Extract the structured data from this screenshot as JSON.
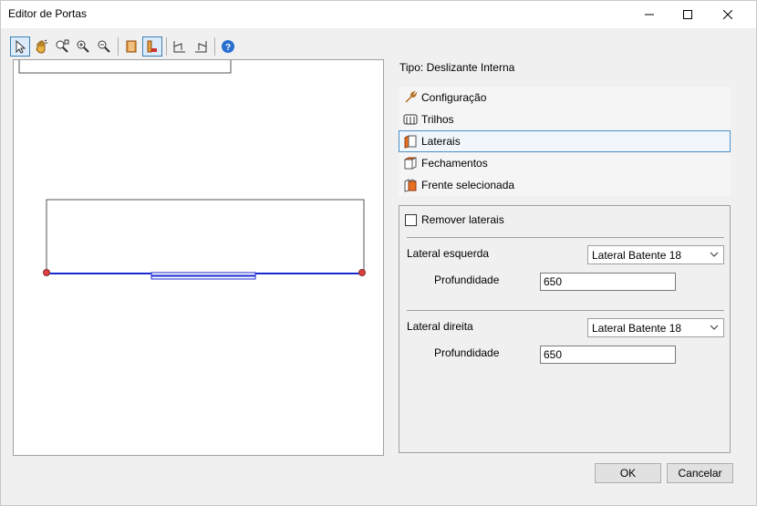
{
  "window": {
    "title": "Editor de Portas"
  },
  "toolbar": {
    "icons": [
      "select-arrow-icon",
      "pan-hand-icon",
      "zoom-window-icon",
      "zoom-in-icon",
      "zoom-out-icon",
      "door-front-icon",
      "door-side-icon",
      "perspective-left-icon",
      "perspective-right-icon",
      "help-icon"
    ]
  },
  "panel": {
    "type_label": "Tipo: Deslizante Interna",
    "sections": [
      {
        "label": "Configuração",
        "icon": "wrench-icon"
      },
      {
        "label": "Trilhos",
        "icon": "rails-icon"
      },
      {
        "label": "Laterais",
        "icon": "side-panel-icon"
      },
      {
        "label": "Fechamentos",
        "icon": "closure-icon"
      },
      {
        "label": "Frente selecionada",
        "icon": "front-selected-icon"
      }
    ],
    "selected_section": "Laterais",
    "details": {
      "remove_sides_label": "Remover laterais",
      "left_side_label": "Lateral esquerda",
      "left_side_value": "Lateral Batente 18",
      "left_depth_label": "Profundidade",
      "left_depth_value": "650",
      "right_side_label": "Lateral direita",
      "right_side_value": "Lateral Batente 18",
      "right_depth_label": "Profundidade",
      "right_depth_value": "650"
    }
  },
  "buttons": {
    "ok": "OK",
    "cancel": "Cancelar"
  }
}
